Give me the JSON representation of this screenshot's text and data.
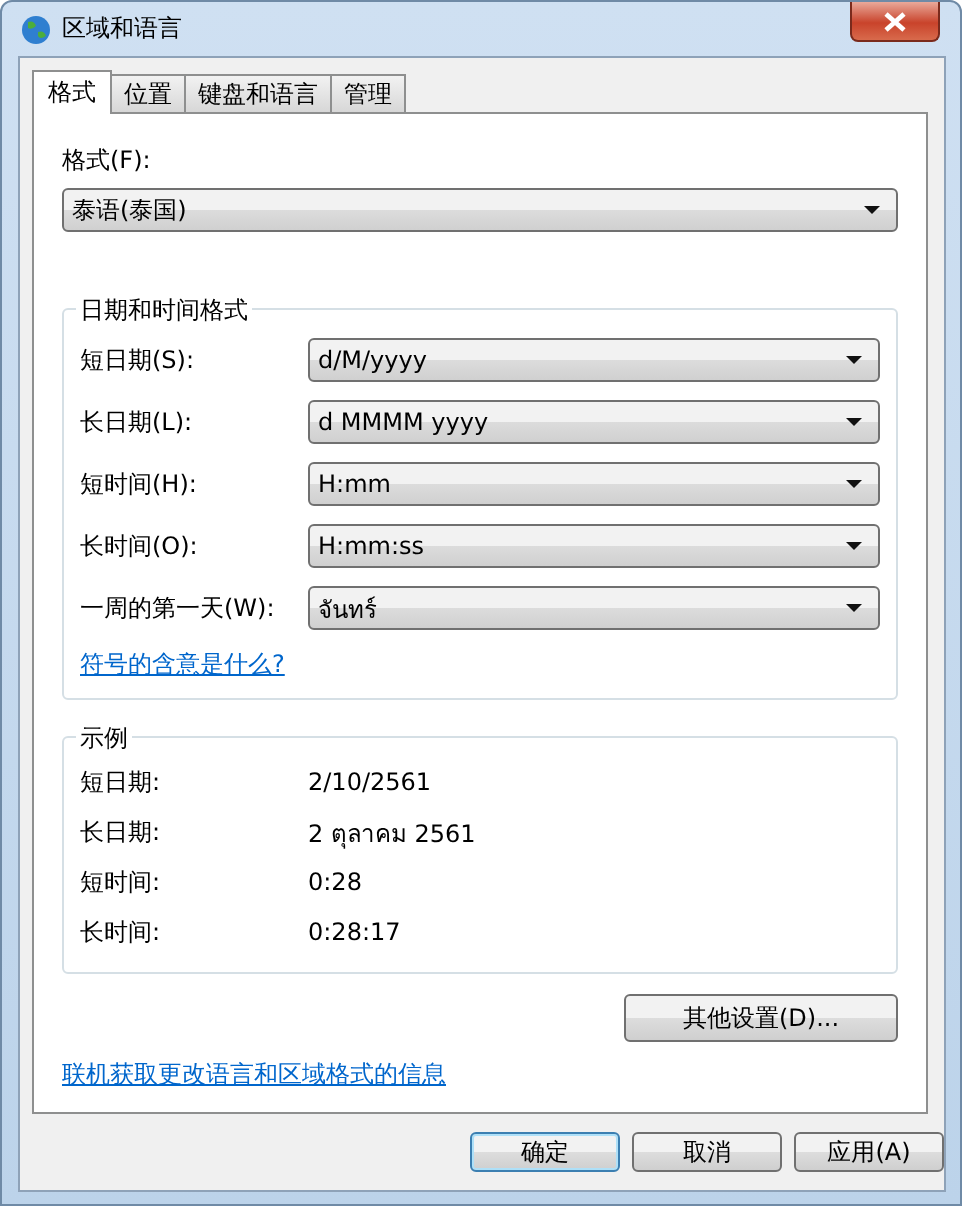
{
  "window": {
    "title": "区域和语言"
  },
  "tabs": [
    {
      "label": "格式",
      "selected": true
    },
    {
      "label": "位置",
      "selected": false
    },
    {
      "label": "键盘和语言",
      "selected": false
    },
    {
      "label": "管理",
      "selected": false
    }
  ],
  "format": {
    "label": "格式(F):",
    "value": "泰语(泰国)"
  },
  "date_time_formats": {
    "title": "日期和时间格式",
    "rows": [
      {
        "label": "短日期(S):",
        "value": "d/M/yyyy"
      },
      {
        "label": "长日期(L):",
        "value": "d MMMM yyyy"
      },
      {
        "label": "短时间(H):",
        "value": "H:mm"
      },
      {
        "label": "长时间(O):",
        "value": "H:mm:ss"
      },
      {
        "label": "一周的第一天(W):",
        "value": "จันทร์"
      }
    ],
    "link": "符号的含意是什么?"
  },
  "examples": {
    "title": "示例",
    "rows": [
      {
        "label": "短日期:",
        "value": "2/10/2561"
      },
      {
        "label": "长日期:",
        "value": "2 ตุลาคม 2561"
      },
      {
        "label": "短时间:",
        "value": "0:28"
      },
      {
        "label": "长时间:",
        "value": "0:28:17"
      }
    ]
  },
  "additional_settings_button": "其他设置(D)...",
  "online_link": "联机获取更改语言和区域格式的信息",
  "buttons": [
    {
      "label": "确定",
      "default": true
    },
    {
      "label": "取消",
      "default": false
    },
    {
      "label": "应用(A)",
      "default": false
    }
  ]
}
